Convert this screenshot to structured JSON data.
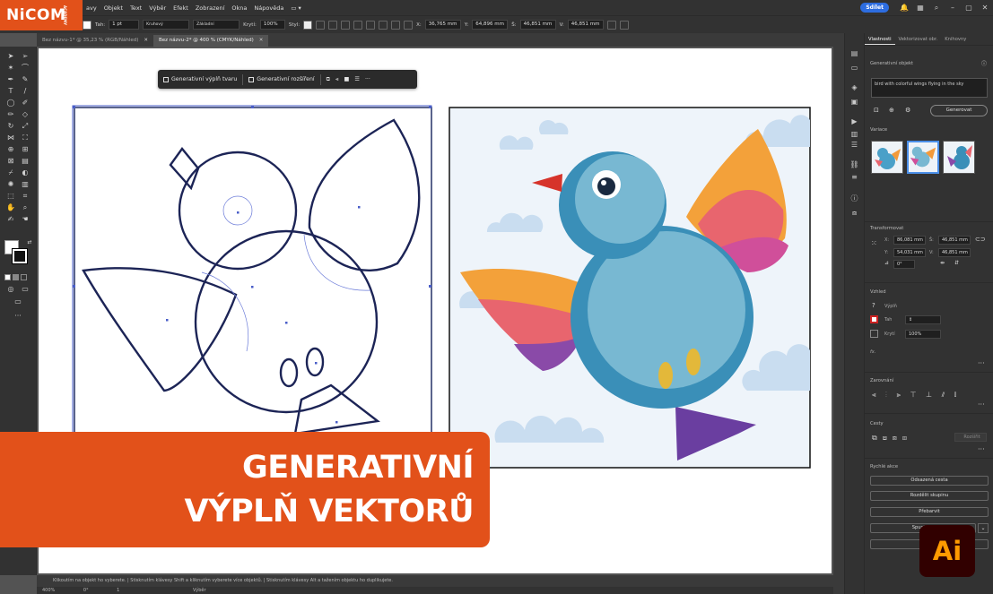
{
  "brand": {
    "logo": "NiCOM",
    "logo_sub": "ACADEMY"
  },
  "menu": {
    "items": [
      "avy",
      "Objekt",
      "Text",
      "Výběr",
      "Efekt",
      "Zobrazení",
      "Okna",
      "Nápověda"
    ],
    "share": "Sdílet"
  },
  "control_bar": {
    "stroke_label": "Tah:",
    "stroke_value": "1 pt",
    "profile1": "Kruhový",
    "profile2": "Základní",
    "opacity_label": "Krytí:",
    "opacity_value": "100%",
    "style_label": "Styl:",
    "x_label": "X:",
    "x_value": "36,765 mm",
    "y_label": "Y:",
    "y_value": "64,896 mm",
    "w_label": "Š:",
    "w_value": "46,851 mm",
    "h_label": "V:",
    "h_value": "46,851 mm"
  },
  "tabs": [
    {
      "label": "Bez názvu-1* @ 35,23 % (RGB/Náhled)"
    },
    {
      "label": "Bez názvu-2* @ 400 % (CMYK/Náhled)"
    }
  ],
  "context_bar": {
    "btn1": "Generativní výplň tvaru",
    "btn2": "Generativní rozšíření"
  },
  "panel": {
    "tabs": [
      "Vlastnosti",
      "Vektorizovat obr.",
      "Knihovny"
    ],
    "gen_object": "Generativní objekt",
    "prompt": "bird with colorful wings flying in the sky",
    "generate": "Generovat",
    "variations": "Variace",
    "transform_title": "Transformovat",
    "x_label": "X:",
    "x": "86,081 mm",
    "y_label": "Y:",
    "y": "54,031 mm",
    "w_label": "Š:",
    "w": "46,851 mm",
    "h_label": "V:",
    "h": "46,851 mm",
    "angle": "0°",
    "appearance_title": "Vzhled",
    "fill_label": "Výplň",
    "stroke_label": "Tah",
    "opacity_label": "Krytí",
    "opacity": "100%",
    "fx": "fx.",
    "align_title": "Zarovnání",
    "pathfinder_title": "Cesty",
    "expand": "Rozšířit",
    "quick_title": "Rychlé akce",
    "quick": [
      "Odsazená cesta",
      "Rozdělit skupinu",
      "Přebarvit",
      "Spustit gl",
      "Gene"
    ]
  },
  "status": {
    "hint": "Klikoutím na objekt ho vyberete.  |  Stisknutím klávesy Shift a kliknutím vyberete více objektů.  |  Stisknutím klávesy Alt a tažením objektu ho duplikujete.",
    "zoom": "400%",
    "angle": "0°",
    "page": "1",
    "mode": "Výběr"
  },
  "banner": {
    "line1": "GENERATIVNÍ",
    "line2": "VÝPLŇ VEKTORŮ"
  },
  "ai_badge": "Ai",
  "colors": {
    "brand_orange": "#e2511a",
    "ai_bg": "#310000",
    "ai_fg": "#ff9a00",
    "share_blue": "#2d6de0",
    "selection": "#2a3a8a"
  }
}
